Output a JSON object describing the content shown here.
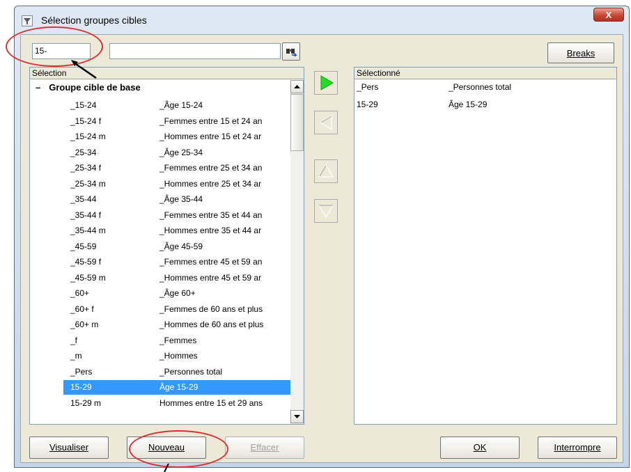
{
  "window": {
    "title": "Sélection groupes cibles",
    "close_label": "X"
  },
  "search": {
    "code_value": "15-",
    "text_value": ""
  },
  "toolbar": {
    "breaks_label": "Breaks"
  },
  "left_panel": {
    "header": "Sélection",
    "group_label": "Groupe cible de base",
    "rows": [
      {
        "code": "_15-24",
        "desc": "_Âge 15-24"
      },
      {
        "code": "_15-24 f",
        "desc": "_Femmes entre 15 et 24 an"
      },
      {
        "code": "_15-24 m",
        "desc": "_Hommes entre 15 et 24 ar"
      },
      {
        "code": "_25-34",
        "desc": "_Âge 25-34"
      },
      {
        "code": "_25-34 f",
        "desc": "_Femmes entre 25 et 34 an"
      },
      {
        "code": "_25-34 m",
        "desc": "_Hommes entre 25 et 34 ar"
      },
      {
        "code": "_35-44",
        "desc": "_Âge 35-44"
      },
      {
        "code": "_35-44 f",
        "desc": "_Femmes entre 35 et 44 an"
      },
      {
        "code": "_35-44 m",
        "desc": "_Hommes entre 35 et 44 ar"
      },
      {
        "code": "_45-59",
        "desc": "_Âge 45-59"
      },
      {
        "code": "_45-59 f",
        "desc": "_Femmes entre 45 et 59 an"
      },
      {
        "code": "_45-59 m",
        "desc": "_Hommes entre 45 et 59 ar"
      },
      {
        "code": "_60+",
        "desc": "_Âge 60+"
      },
      {
        "code": "_60+ f",
        "desc": "_Femmes de 60 ans et plus"
      },
      {
        "code": "_60+ m",
        "desc": "_Hommes de 60 ans et plus"
      },
      {
        "code": "_f",
        "desc": "_Femmes"
      },
      {
        "code": "_m",
        "desc": "_Hommes"
      },
      {
        "code": "_Pers",
        "desc": "_Personnes total"
      },
      {
        "code": "15-29",
        "desc": "Âge 15-29",
        "selected": true
      },
      {
        "code": "15-29 m",
        "desc": "Hommes entre 15 et 29 ans"
      }
    ]
  },
  "right_panel": {
    "header": "Sélectionné",
    "rows": [
      {
        "code": "_Pers",
        "desc": "_Personnes total"
      },
      {
        "code": "15-29",
        "desc": "Âge 15-29"
      }
    ]
  },
  "buttons": {
    "visualiser": "Visualiser",
    "nouveau": "Nouveau",
    "effacer": "Effacer",
    "ok": "OK",
    "interrompre": "Interrompre"
  },
  "colors": {
    "selection": "#3399ff",
    "accent_green": "#22dd22",
    "annotation": "#e03030"
  }
}
